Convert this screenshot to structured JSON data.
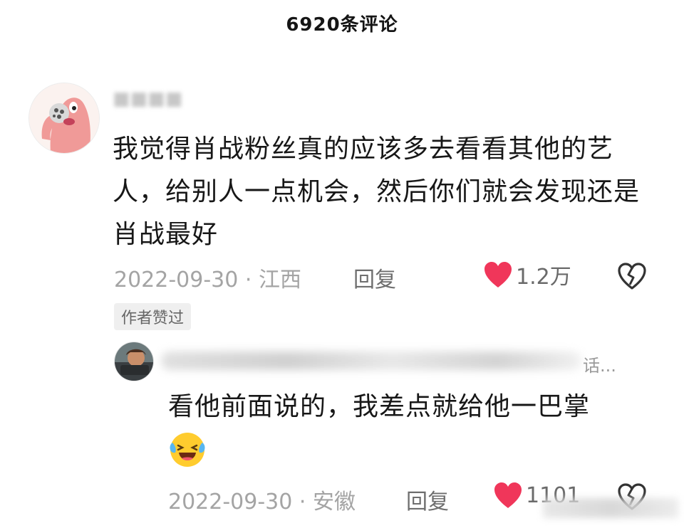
{
  "header": {
    "title": "6920条评论"
  },
  "comment": {
    "text": "我觉得肖战粉丝真的应该多去看看其他的艺人，给别人一点机会，然后你们就会发现还是肖战最好",
    "date_location": "2022-09-30 · 江西",
    "reply_label": "回复",
    "likes": "1.2万",
    "author_badge": "作者赞过"
  },
  "reply": {
    "username_tail": "话...",
    "text": "看他前面说的，我差点就给他一巴掌",
    "emoji": "laughing-crying-emoji",
    "date_location": "2022-09-30 · 安徽",
    "reply_label": "回复",
    "likes": "1101"
  },
  "colors": {
    "like_red": "#f0365a",
    "meta_gray": "#a4a4a4",
    "text_dark": "#171717"
  }
}
